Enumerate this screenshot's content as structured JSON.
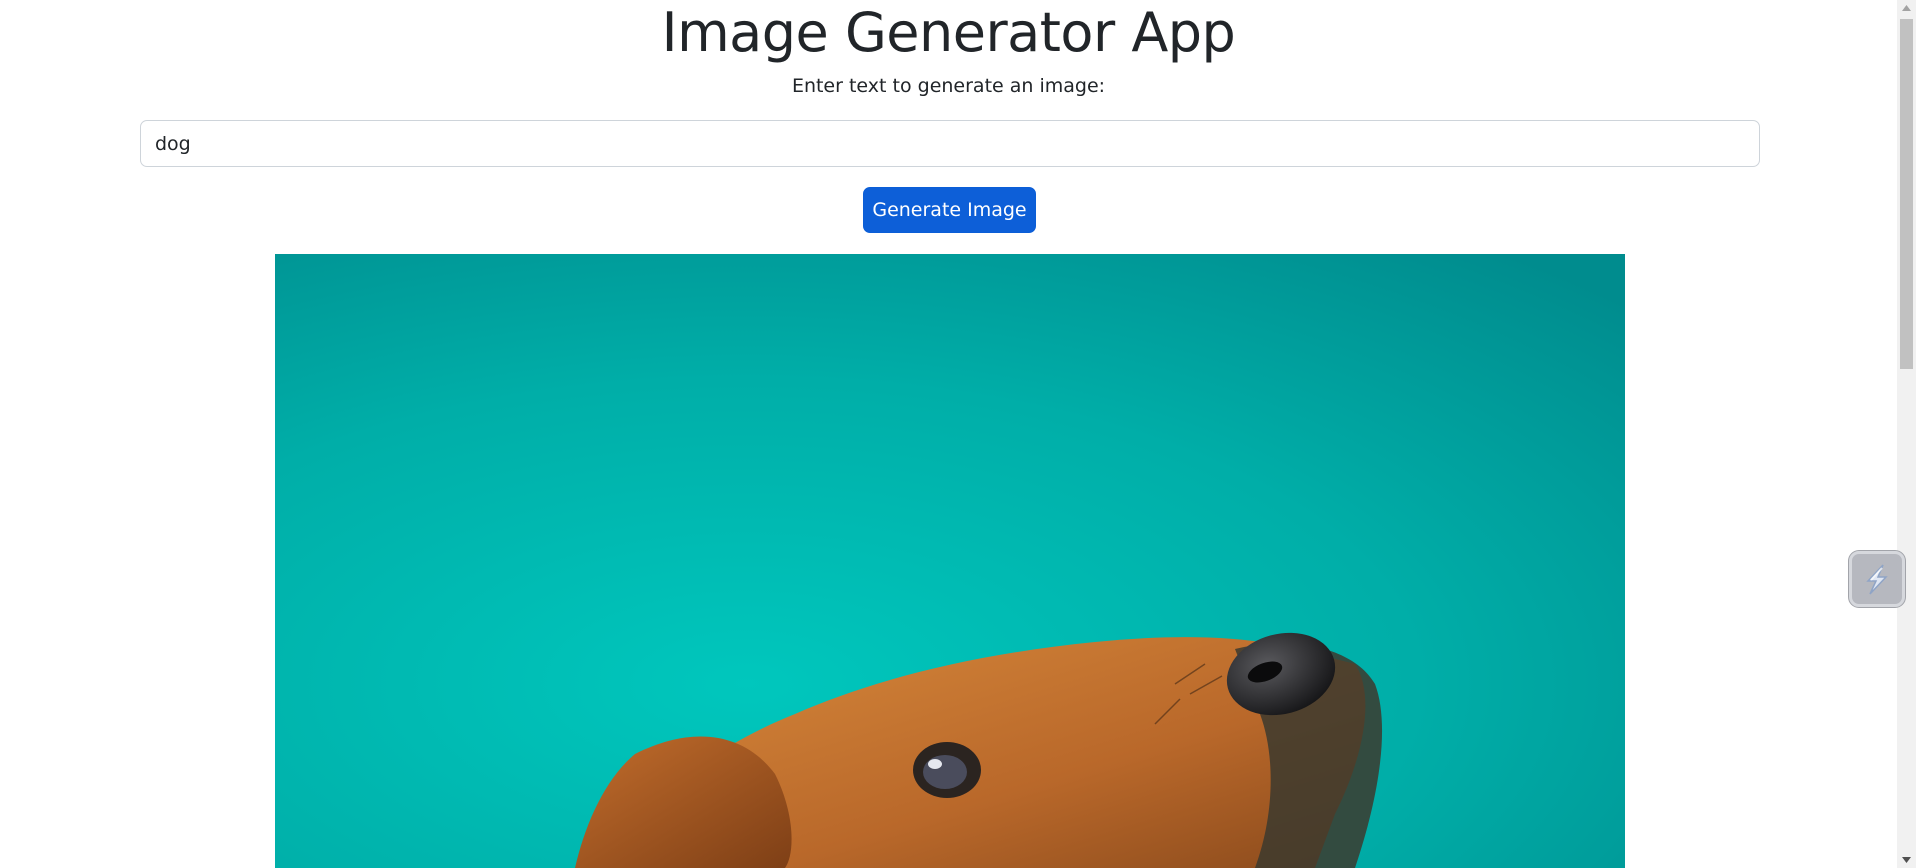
{
  "header": {
    "title": "Image Generator App",
    "prompt_label": "Enter text to generate an image:"
  },
  "form": {
    "input_value": "dog",
    "generate_button_label": "Generate Image"
  },
  "result": {
    "image_subject": "dachshund-on-teal-background",
    "background_color": "#00a8a2"
  },
  "theme": {
    "accent": "#0d5fd8",
    "input_border": "#ced4da",
    "text_color": "#212529"
  },
  "widgets": {
    "floating_icon": "lightning-bolt-icon"
  }
}
